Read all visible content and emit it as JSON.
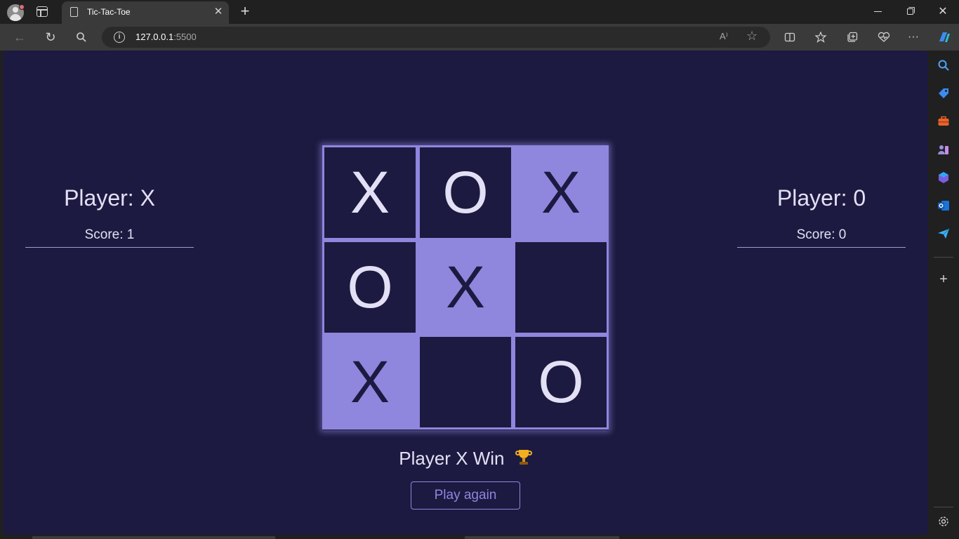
{
  "browser": {
    "tab_title": "Tic-Tac-Toe",
    "url_host": "127.0.0.1",
    "url_port": ":5500",
    "read_aloud": "A⁾"
  },
  "game": {
    "player_left": {
      "name": "Player: X",
      "score": "Score: 1"
    },
    "player_right": {
      "name": "Player: 0",
      "score": "Score: 0"
    },
    "board": [
      {
        "mark": "X",
        "highlighted": false
      },
      {
        "mark": "O",
        "highlighted": false
      },
      {
        "mark": "X",
        "highlighted": true
      },
      {
        "mark": "O",
        "highlighted": false
      },
      {
        "mark": "X",
        "highlighted": true
      },
      {
        "mark": "",
        "highlighted": false
      },
      {
        "mark": "X",
        "highlighted": true
      },
      {
        "mark": "",
        "highlighted": false
      },
      {
        "mark": "O",
        "highlighted": false
      }
    ],
    "result_text": "Player X Win",
    "result_icon": "trophy-icon",
    "play_again_label": "Play again"
  },
  "colors": {
    "background": "#1c1a40",
    "accent": "#8f86de",
    "text": "#e3e0f5"
  }
}
